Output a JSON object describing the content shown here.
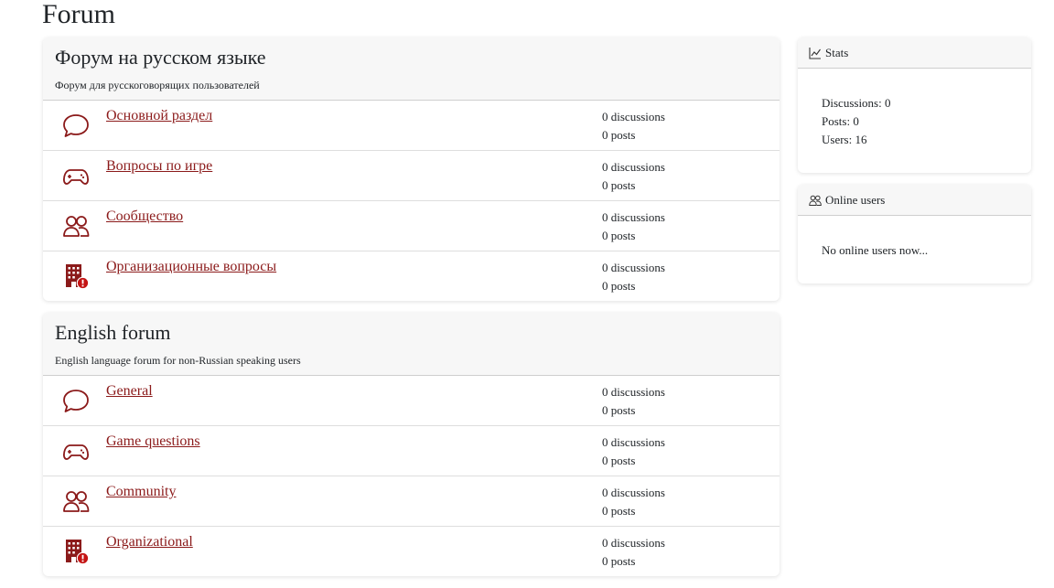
{
  "page": {
    "title": "Forum"
  },
  "colors": {
    "accent": "#8b1a1a"
  },
  "forums": [
    {
      "title": "Форум на русском языке",
      "description": "Форум для русскоговорящих пользователей",
      "subforums": [
        {
          "icon": "chat-bubble-icon",
          "name": "Основной раздел",
          "discussions": "0 discussions",
          "posts": "0 posts"
        },
        {
          "icon": "gamepad-icon",
          "name": "Вопросы по игре",
          "discussions": "0 discussions",
          "posts": "0 posts"
        },
        {
          "icon": "people-icon",
          "name": "Сообщество",
          "discussions": "0 discussions",
          "posts": "0 posts"
        },
        {
          "icon": "building-alert-icon",
          "name": "Организационные вопросы",
          "discussions": "0 discussions",
          "posts": "0 posts"
        }
      ]
    },
    {
      "title": "English forum",
      "description": "English language forum for non-Russian speaking users",
      "subforums": [
        {
          "icon": "chat-bubble-icon",
          "name": "General",
          "discussions": "0 discussions",
          "posts": "0 posts"
        },
        {
          "icon": "gamepad-icon",
          "name": "Game questions",
          "discussions": "0 discussions",
          "posts": "0 posts"
        },
        {
          "icon": "people-icon",
          "name": "Community",
          "discussions": "0 discussions",
          "posts": "0 posts"
        },
        {
          "icon": "building-alert-icon",
          "name": "Organizational",
          "discussions": "0 discussions",
          "posts": "0 posts"
        }
      ]
    }
  ],
  "stats": {
    "header": "Stats",
    "icon": "chart-line-icon",
    "discussions": "Discussions: 0",
    "posts": "Posts: 0",
    "users": "Users: 16"
  },
  "online": {
    "header": "Online users",
    "icon": "people-icon",
    "message": "No online users now..."
  }
}
